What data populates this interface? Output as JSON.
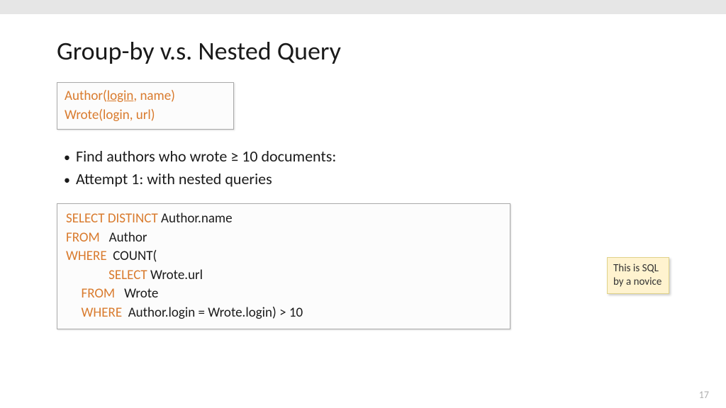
{
  "title": "Group-by v.s. Nested Query",
  "schema": {
    "line1_a": "Author(",
    "line1_b": "login",
    "line1_c": ", name)",
    "line2": "Wrote(login, url)"
  },
  "bullets": {
    "b1": "Find authors who wrote ≥ 10 documents:",
    "b2": "Attempt 1: with nested queries"
  },
  "sql": {
    "l1_kw": "SELECT DISTINCT ",
    "l1_txt": "Author.name",
    "l2_kw": "FROM   ",
    "l2_txt": "Author",
    "l3_kw": "WHERE  ",
    "l3_txt": "COUNT(",
    "l4_pad": "              ",
    "l4_kw": "SELECT ",
    "l4_txt": "Wrote.url",
    "l5_pad": "     ",
    "l5_kw": "FROM   ",
    "l5_txt": "Wrote",
    "l6_pad": "     ",
    "l6_kw": "WHERE  ",
    "l6_txt": "Author.login = Wrote.login) > 10"
  },
  "note": "This is SQL by a novice",
  "page": "17"
}
